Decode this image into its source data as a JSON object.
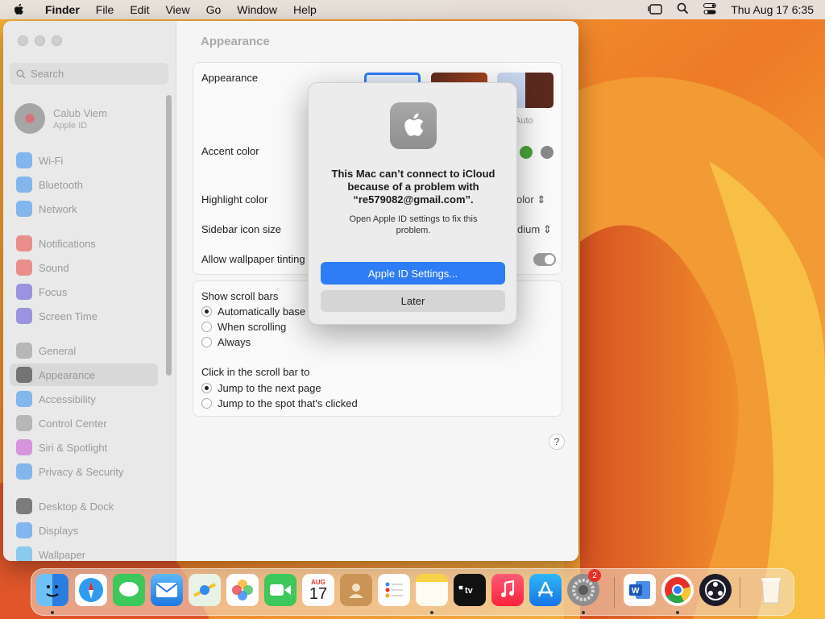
{
  "menubar": {
    "items": [
      "Finder",
      "File",
      "Edit",
      "View",
      "Go",
      "Window",
      "Help"
    ],
    "clock": "Thu Aug 17  6:35"
  },
  "sidebar": {
    "search_placeholder": "Search",
    "profile": {
      "name": "Calub Viem",
      "subtitle": "Apple ID"
    },
    "items": [
      {
        "label": "Wi-Fi",
        "icon": "wifi-icon",
        "color": "#2d8cf0"
      },
      {
        "label": "Bluetooth",
        "icon": "bluetooth-icon",
        "color": "#2d8cf0"
      },
      {
        "label": "Network",
        "icon": "globe-icon",
        "color": "#2d8cf0"
      },
      {
        "label": "Notifications",
        "icon": "bell-icon",
        "color": "#e8453c"
      },
      {
        "label": "Sound",
        "icon": "speaker-icon",
        "color": "#e8453c"
      },
      {
        "label": "Focus",
        "icon": "moon-icon",
        "color": "#5b4cd6"
      },
      {
        "label": "Screen Time",
        "icon": "hourglass-icon",
        "color": "#5b4cd6"
      },
      {
        "label": "General",
        "icon": "gear-icon",
        "color": "#8e8e8e"
      },
      {
        "label": "Appearance",
        "icon": "appearance-icon",
        "color": "#222222"
      },
      {
        "label": "Accessibility",
        "icon": "accessibility-icon",
        "color": "#2d8cf0"
      },
      {
        "label": "Control Center",
        "icon": "control-center-icon",
        "color": "#8e8e8e"
      },
      {
        "label": "Siri & Spotlight",
        "icon": "siri-icon",
        "color": "#c74fd1"
      },
      {
        "label": "Privacy & Security",
        "icon": "hand-icon",
        "color": "#2d8cf0"
      },
      {
        "label": "Desktop & Dock",
        "icon": "dock-icon",
        "color": "#222222"
      },
      {
        "label": "Displays",
        "icon": "display-icon",
        "color": "#2d8cf0"
      },
      {
        "label": "Wallpaper",
        "icon": "wallpaper-icon",
        "color": "#3ab0f0"
      }
    ]
  },
  "main": {
    "title": "Appearance",
    "appearance_label": "Appearance",
    "auto_label": "Auto",
    "accent_label": "Accent color",
    "highlight_label": "Highlight color",
    "highlight_value": "olor",
    "sidebar_icon_label": "Sidebar icon size",
    "sidebar_icon_value": "dium",
    "tinting_label": "Allow wallpaper tinting",
    "scroll_bars_label": "Show scroll bars",
    "scroll_options": [
      "Automatically base",
      "When scrolling",
      "Always"
    ],
    "click_label": "Click in the scroll bar to",
    "click_options": [
      "Jump to the next page",
      "Jump to the spot that's clicked"
    ],
    "help": "?"
  },
  "dialog": {
    "title": "This Mac can’t connect to iCloud because of a problem with “re579082@gmail.com”.",
    "message": "Open Apple ID settings to fix this problem.",
    "primary": "Apple ID Settings...",
    "secondary": "Later"
  },
  "dock": {
    "calendar_month": "AUG",
    "calendar_day": "17",
    "settings_badge": "2"
  }
}
